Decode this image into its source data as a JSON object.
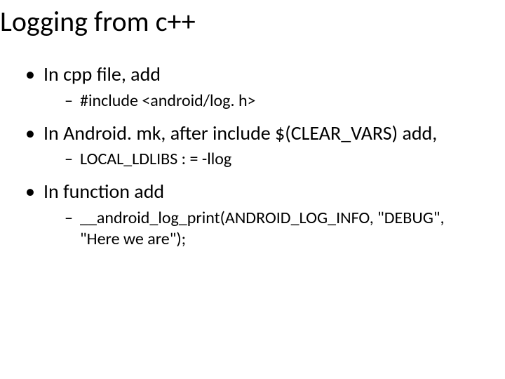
{
  "title": "Logging from c++",
  "bullets": [
    {
      "text": "In cpp file, add",
      "sub": [
        "#include <android/log. h>"
      ]
    },
    {
      "text": "In Android. mk, after include $(CLEAR_VARS) add,",
      "sub": [
        "LOCAL_LDLIBS : = -llog"
      ]
    },
    {
      "text": "In function add",
      "sub": [
        "__android_log_print(ANDROID_LOG_INFO, \"DEBUG\", \"Here we are\");"
      ]
    }
  ]
}
